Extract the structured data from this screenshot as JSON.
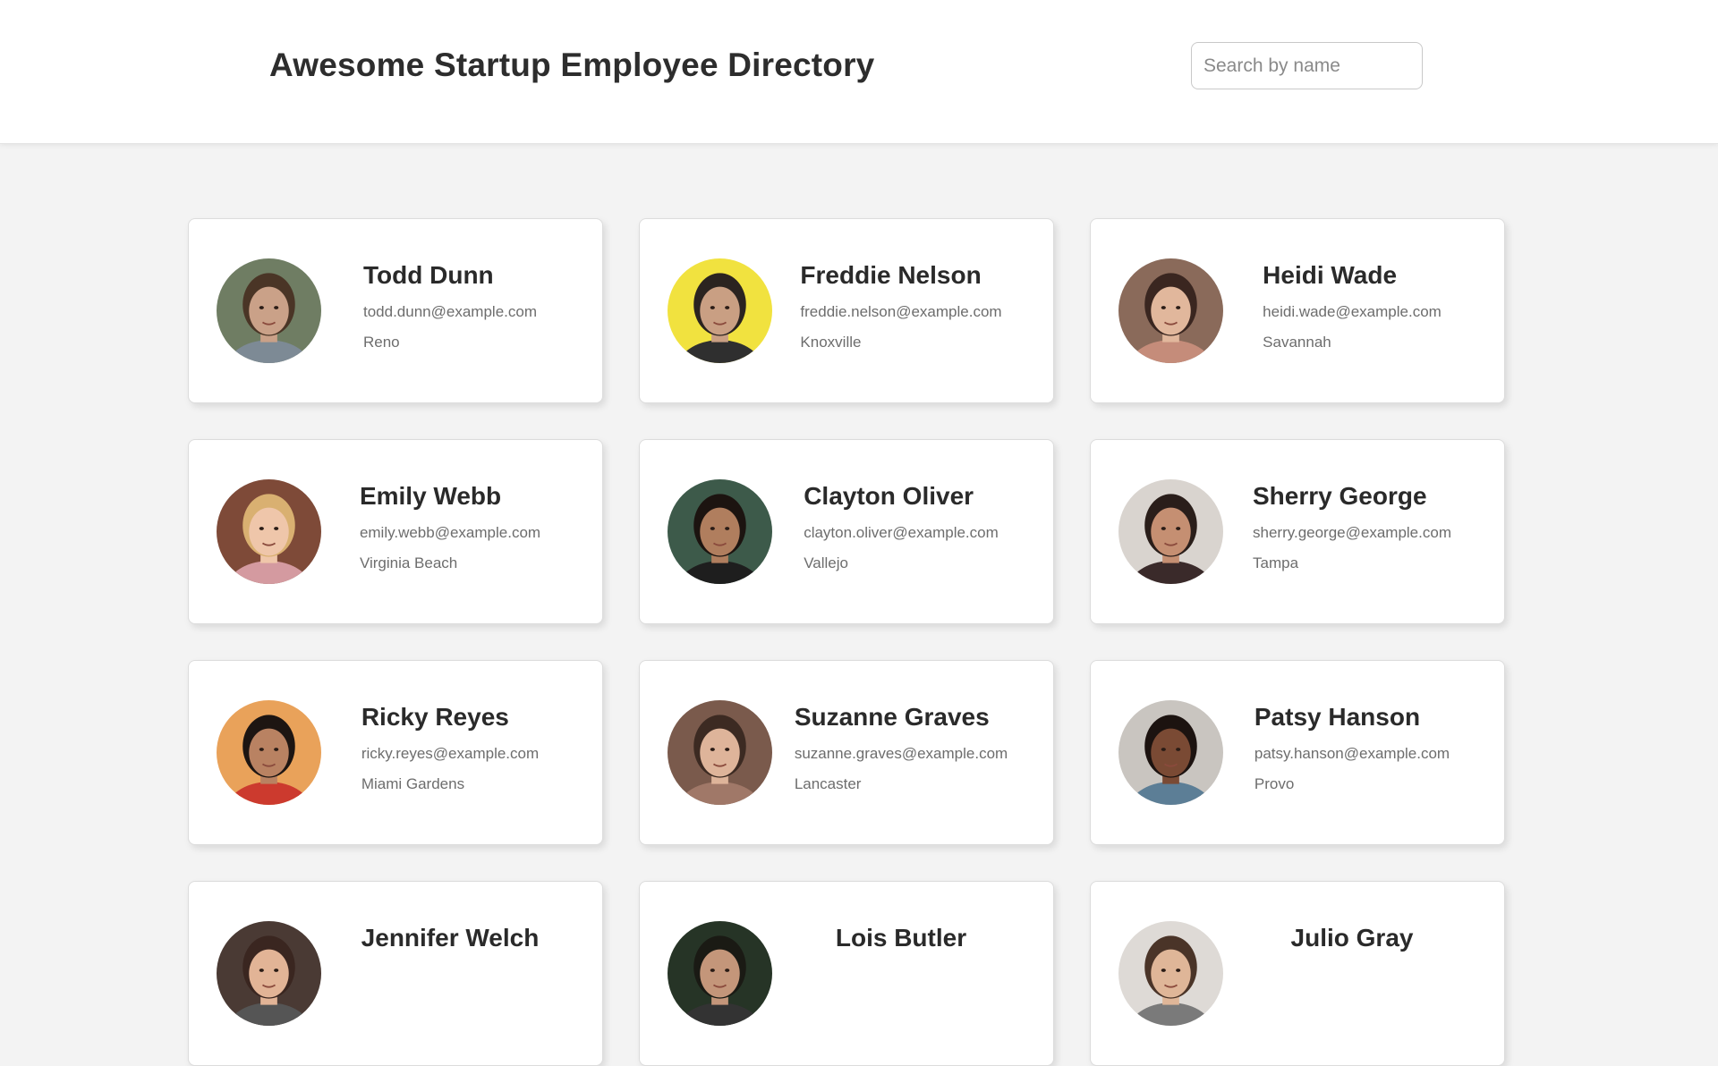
{
  "header": {
    "title": "Awesome Startup Employee Directory",
    "search_placeholder": "Search by name",
    "search_value": ""
  },
  "employees": [
    {
      "name": "Todd Dunn",
      "email": "todd.dunn@example.com",
      "city": "Reno",
      "avatar": {
        "bg": "#6f7d63",
        "skin": "#caa188",
        "hair": "#4a3526",
        "shirt": "#7d8a95"
      }
    },
    {
      "name": "Freddie Nelson",
      "email": "freddie.nelson@example.com",
      "city": "Knoxville",
      "avatar": {
        "bg": "#f1e23f",
        "skin": "#c99f83",
        "hair": "#2b2420",
        "shirt": "#2f2f2f"
      }
    },
    {
      "name": "Heidi Wade",
      "email": "heidi.wade@example.com",
      "city": "Savannah",
      "avatar": {
        "bg": "#8a6a5a",
        "skin": "#e1b79c",
        "hair": "#3a2620",
        "shirt": "#c58c7a"
      }
    },
    {
      "name": "Emily Webb",
      "email": "emily.webb@example.com",
      "city": "Virginia Beach",
      "avatar": {
        "bg": "#7e4a38",
        "skin": "#efc6aa",
        "hair": "#d9b071",
        "shirt": "#d49aa0"
      }
    },
    {
      "name": "Clayton Oliver",
      "email": "clayton.oliver@example.com",
      "city": "Vallejo",
      "avatar": {
        "bg": "#3d5a4a",
        "skin": "#b07e5e",
        "hair": "#1c1410",
        "shirt": "#1e1e1e"
      }
    },
    {
      "name": "Sherry George",
      "email": "sherry.george@example.com",
      "city": "Tampa",
      "avatar": {
        "bg": "#d9d4cf",
        "skin": "#c58f72",
        "hair": "#2a1e1a",
        "shirt": "#3a2a2a"
      }
    },
    {
      "name": "Ricky Reyes",
      "email": "ricky.reyes@example.com",
      "city": "Miami Gardens",
      "avatar": {
        "bg": "#e9a25a",
        "skin": "#b98262",
        "hair": "#1d1512",
        "shirt": "#cc3a2e"
      }
    },
    {
      "name": "Suzanne Graves",
      "email": "suzanne.graves@example.com",
      "city": "Lancaster",
      "avatar": {
        "bg": "#7a5a4c",
        "skin": "#deb49a",
        "hair": "#3c2a22",
        "shirt": "#a07868"
      }
    },
    {
      "name": "Patsy Hanson",
      "email": "patsy.hanson@example.com",
      "city": "Provo",
      "avatar": {
        "bg": "#c9c5c0",
        "skin": "#7a4a34",
        "hair": "#1c1310",
        "shirt": "#5c7e96"
      }
    },
    {
      "name": "Jennifer Welch",
      "email": "",
      "city": "",
      "avatar": {
        "bg": "#4a3a34",
        "skin": "#e2b496",
        "hair": "#3a2620",
        "shirt": "#555555"
      }
    },
    {
      "name": "Lois Butler",
      "email": "",
      "city": "",
      "avatar": {
        "bg": "#263426",
        "skin": "#c4967a",
        "hair": "#1a1a14",
        "shirt": "#333333"
      }
    },
    {
      "name": "Julio Gray",
      "email": "",
      "city": "",
      "avatar": {
        "bg": "#dedad6",
        "skin": "#dfb698",
        "hair": "#4a3428",
        "shirt": "#7a7a7a"
      }
    }
  ]
}
